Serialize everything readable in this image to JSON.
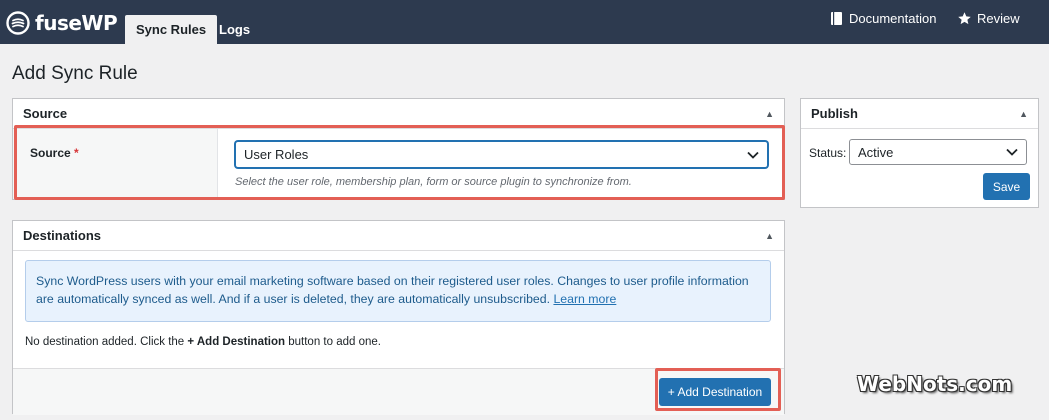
{
  "app": {
    "name": "fuseWP"
  },
  "tabs": [
    {
      "label": "Sync Rules",
      "active": true
    },
    {
      "label": "Logs",
      "active": false
    }
  ],
  "header_links": {
    "documentation": "Documentation",
    "review": "Review"
  },
  "page": {
    "title": "Add Sync Rule"
  },
  "source_box": {
    "title": "Source",
    "field_label": "Source",
    "required_mark": "*",
    "selected_value": "User Roles",
    "hint": "Select the user role, membership plan, form or source plugin to synchronize from."
  },
  "destinations_box": {
    "title": "Destinations",
    "notice_text": "Sync WordPress users with your email marketing software based on their registered user roles. Changes to user profile information are automatically synced as well. And if a user is deleted, they are automatically unsubscribed.",
    "notice_link": "Learn more",
    "empty_prefix": "No destination added. Click the",
    "empty_strong": "+ Add Destination",
    "empty_suffix": "button to add one.",
    "add_button": "+ Add Destination"
  },
  "publish_box": {
    "title": "Publish",
    "status_label": "Status:",
    "status_value": "Active",
    "save_button": "Save"
  },
  "watermark": "WebNots.com",
  "colors": {
    "topbar": "#2d3a4f",
    "primary_button": "#2271b1",
    "highlight": "#e35f55",
    "notice_bg": "#e8f2fd"
  }
}
